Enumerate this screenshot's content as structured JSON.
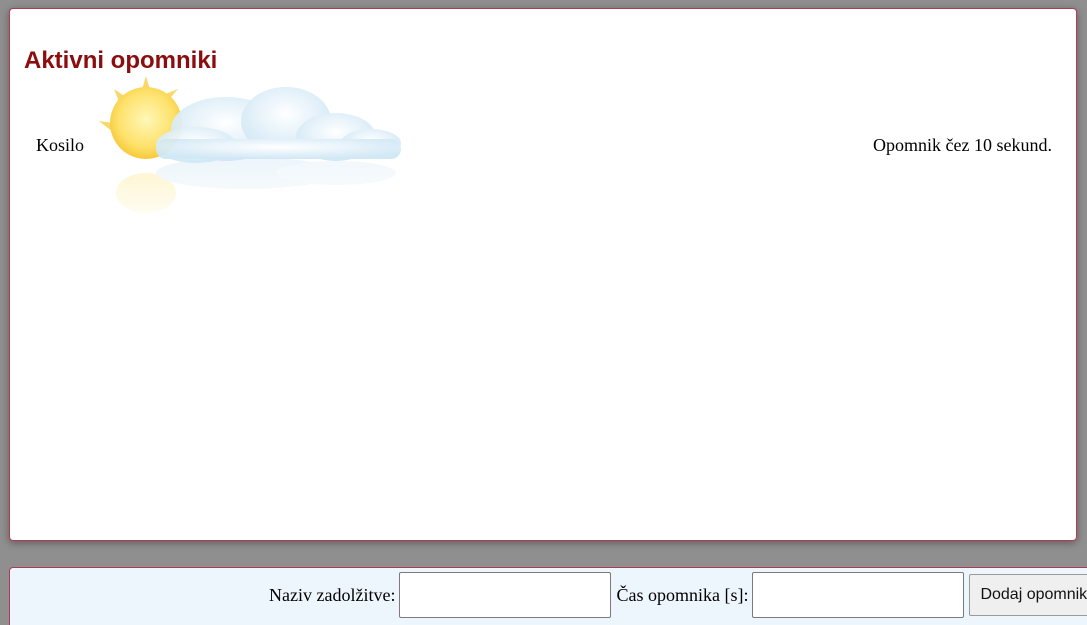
{
  "panel": {
    "title": "Aktivni opomniki",
    "reminders": [
      {
        "name": "Kosilo",
        "status": "Opomnik čez 10 sekund."
      }
    ]
  },
  "form": {
    "name_label": "Naziv zadolžitve:",
    "name_value": "",
    "time_label": "Čas opomnika [s]:",
    "time_value": "",
    "add_button_label": "Dodaj opomnik"
  },
  "icons": {
    "weather": "sun-behind-cloud-icon"
  },
  "colors": {
    "title": "#8b0d0d",
    "border": "#b23a52",
    "footer_bg": "#eef6fd",
    "page_bg": "#8f8f8f"
  }
}
